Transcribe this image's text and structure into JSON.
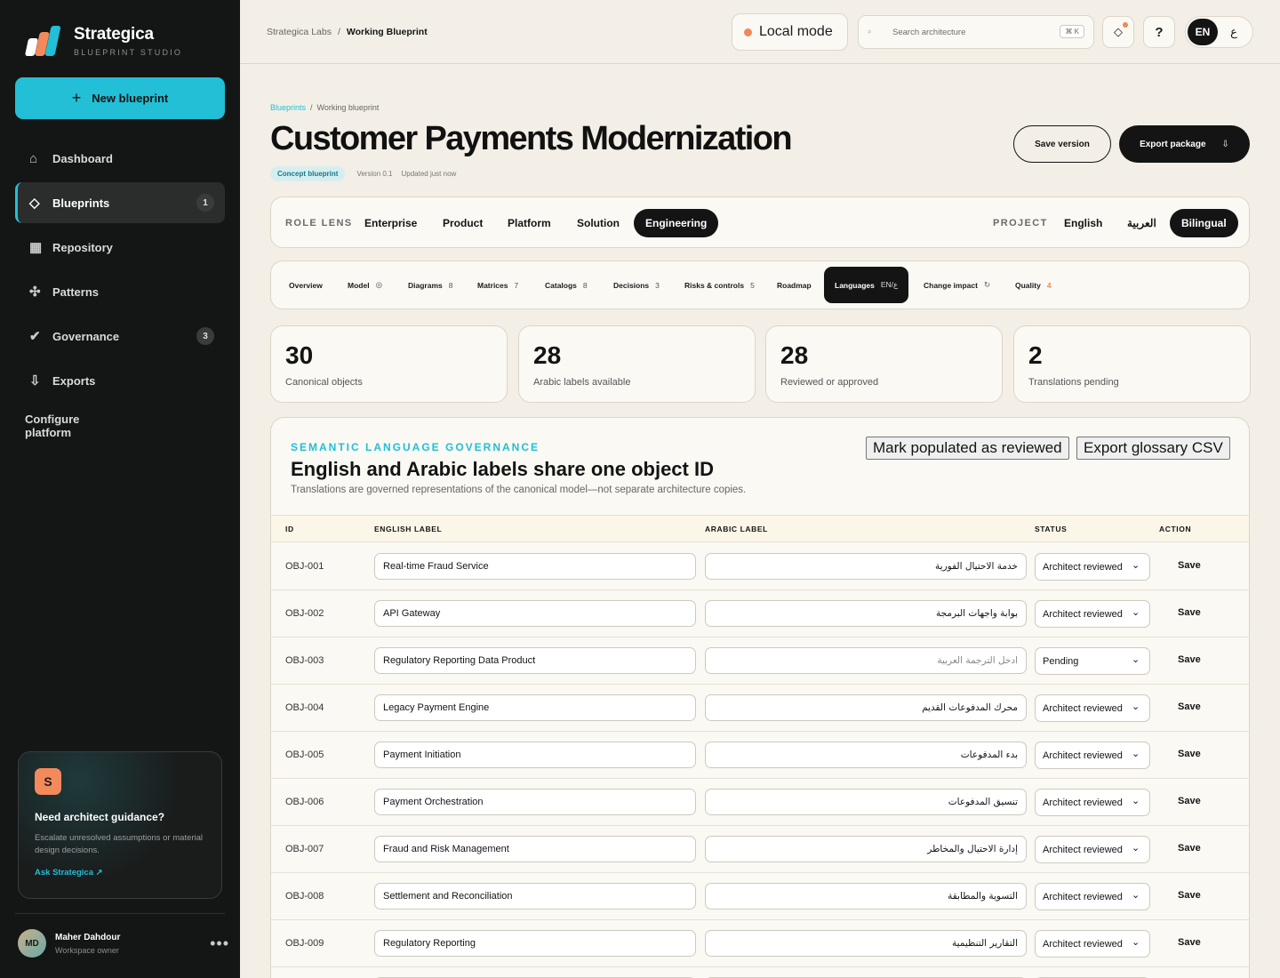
{
  "brand": {
    "name": "Strategica",
    "subtitle": "BLUEPRINT STUDIO",
    "logo_colors": [
      "#ffffff",
      "#f38a5b",
      "#22bfd6"
    ]
  },
  "sidebar": {
    "new_button": "New blueprint",
    "items": [
      {
        "label": "Dashboard",
        "icon": "home-icon",
        "glyph": "⌂",
        "badge": ""
      },
      {
        "label": "Blueprints",
        "icon": "diamond-icon",
        "glyph": "◇",
        "badge": "1",
        "active": true
      },
      {
        "label": "Repository",
        "icon": "grid-icon",
        "glyph": "▦",
        "badge": ""
      },
      {
        "label": "Patterns",
        "icon": "nodes-icon",
        "glyph": "✣",
        "badge": ""
      },
      {
        "label": "Governance",
        "icon": "check-icon",
        "glyph": "✔",
        "badge": "3"
      },
      {
        "label": "Exports",
        "icon": "download-icon",
        "glyph": "⇩",
        "badge": ""
      }
    ],
    "configure": "Configure platform",
    "guidance": {
      "letter": "S",
      "title": "Need architect guidance?",
      "text": "Escalate unresolved assumptions or material design decisions.",
      "link": "Ask Strategica ↗"
    },
    "user": {
      "initials": "MD",
      "name": "Maher Dahdour",
      "role": "Workspace owner"
    }
  },
  "topbar": {
    "crumb_parent": "Strategica Labs",
    "crumb_sep": "/",
    "crumb_current": "Working Blueprint",
    "local_mode": "Local mode",
    "search_placeholder": "Search architecture",
    "search_shortcut": "⌘ K",
    "help": "?",
    "lang_en": "EN",
    "lang_ar": "ع"
  },
  "page": {
    "crumb_link": "Blueprints",
    "crumb_sep": "/",
    "crumb_current": "Working blueprint",
    "title": "Customer Payments Modernization",
    "chip": "Concept blueprint",
    "version": "Version 0.1",
    "updated": "Updated just now",
    "save_version": "Save version",
    "export_package": "Export package",
    "export_arrow": "⇩"
  },
  "role_lens": {
    "label": "ROLE LENS",
    "options": [
      "Enterprise",
      "Product",
      "Platform",
      "Solution",
      "Engineering"
    ],
    "active": "Engineering",
    "project_label": "PROJECT",
    "project_options": [
      "English",
      "العربية",
      "Bilingual"
    ],
    "project_active": "Bilingual"
  },
  "tabs": [
    {
      "label": "Overview",
      "count": ""
    },
    {
      "label": "Model",
      "count": "◎"
    },
    {
      "label": "Diagrams",
      "count": "8"
    },
    {
      "label": "Matrices",
      "count": "7"
    },
    {
      "label": "Catalogs",
      "count": "8"
    },
    {
      "label": "Decisions",
      "count": "3"
    },
    {
      "label": "Risks & controls",
      "count": "5"
    },
    {
      "label": "Roadmap",
      "count": ""
    },
    {
      "label": "Languages",
      "count": "EN/ع",
      "active": true
    },
    {
      "label": "Change impact",
      "count": "↻"
    },
    {
      "label": "Quality",
      "count": "4",
      "warn": true
    }
  ],
  "stats": [
    {
      "value": "30",
      "label": "Canonical objects"
    },
    {
      "value": "28",
      "label": "Arabic labels available"
    },
    {
      "value": "28",
      "label": "Reviewed or approved"
    },
    {
      "value": "2",
      "label": "Translations pending"
    }
  ],
  "governance": {
    "eyebrow": "SEMANTIC LANGUAGE GOVERNANCE",
    "title": "English and Arabic labels share one object ID",
    "subtitle": "Translations are governed representations of the canonical model—not separate architecture copies.",
    "mark_button": "Mark populated as reviewed",
    "export_button": "Export glossary CSV",
    "columns": [
      "ID",
      "ENGLISH LABEL",
      "ARABIC LABEL",
      "STATUS",
      "ACTION"
    ],
    "arabic_placeholder": "ادخل الترجمة العربية",
    "status_options": [
      "Architect reviewed",
      "Pending"
    ],
    "action_label": "Save",
    "rows": [
      {
        "id": "OBJ-001",
        "en": "Real-time Fraud Service",
        "ar": "خدمة الاحتيال الفورية",
        "status": "Architect reviewed"
      },
      {
        "id": "OBJ-002",
        "en": "API Gateway",
        "ar": "بوابة واجهات البرمجة",
        "status": "Architect reviewed"
      },
      {
        "id": "OBJ-003",
        "en": "Regulatory Reporting Data Product",
        "ar": "",
        "status": "Pending"
      },
      {
        "id": "OBJ-004",
        "en": "Legacy Payment Engine",
        "ar": "محرك المدفوعات القديم",
        "status": "Architect reviewed"
      },
      {
        "id": "OBJ-005",
        "en": "Payment Initiation",
        "ar": "بدء المدفوعات",
        "status": "Architect reviewed"
      },
      {
        "id": "OBJ-006",
        "en": "Payment Orchestration",
        "ar": "تنسيق المدفوعات",
        "status": "Architect reviewed"
      },
      {
        "id": "OBJ-007",
        "en": "Fraud and Risk Management",
        "ar": "إدارة الاحتيال والمخاطر",
        "status": "Architect reviewed"
      },
      {
        "id": "OBJ-008",
        "en": "Settlement and Reconciliation",
        "ar": "التسوية والمطابقة",
        "status": "Architect reviewed"
      },
      {
        "id": "OBJ-009",
        "en": "Regulatory Reporting",
        "ar": "التقارير التنظيمية",
        "status": "Architect reviewed"
      },
      {
        "id": "",
        "en": "",
        "ar": "",
        "status": ""
      }
    ]
  }
}
